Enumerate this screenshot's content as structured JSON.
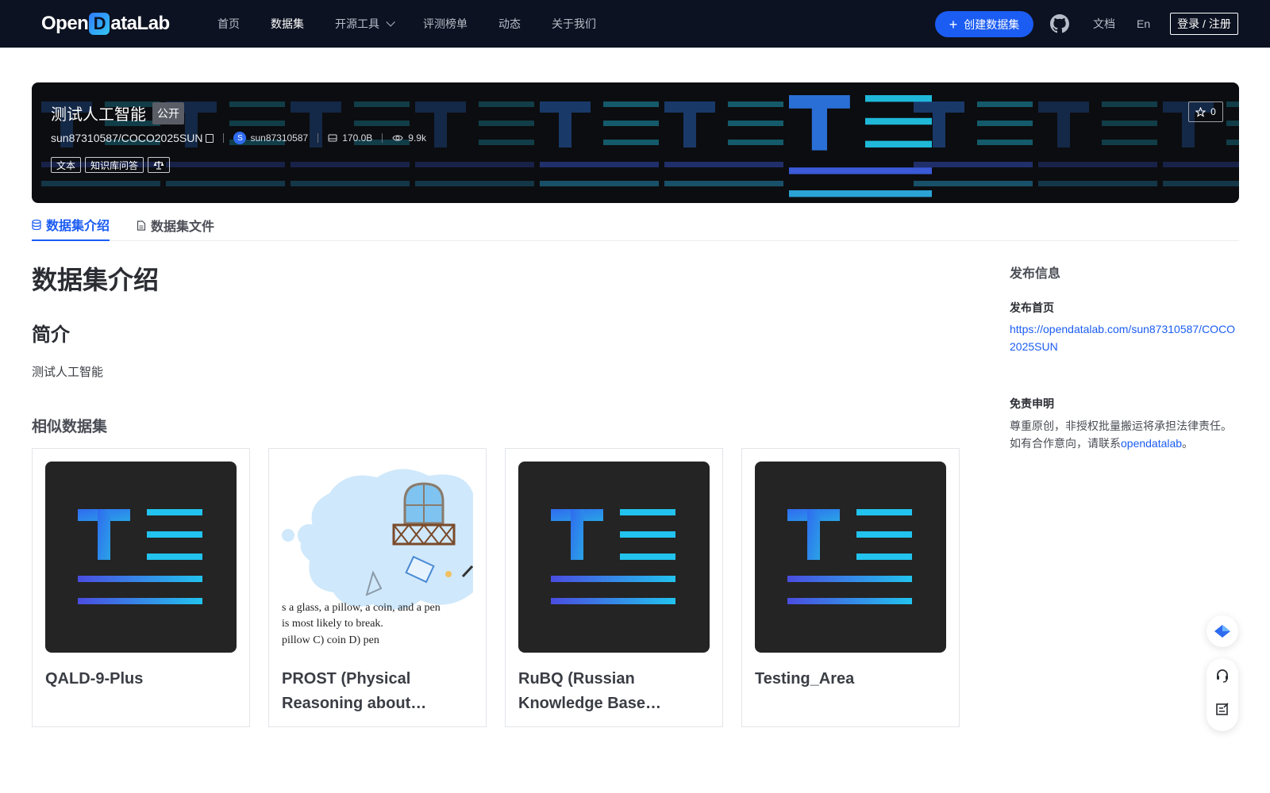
{
  "nav": {
    "logo_left": "Open",
    "logo_d": "D",
    "logo_right": "ataLab",
    "links": [
      "首页",
      "数据集",
      "开源工具",
      "评测榜单",
      "动态",
      "关于我们"
    ],
    "create_label": "创建数据集",
    "docs_label": "文档",
    "lang_label": "En",
    "login_label": "登录 / 注册"
  },
  "banner": {
    "title": "测试人工智能",
    "badge": "公开",
    "path": "sun87310587/COCO2025SUN",
    "avatar_letter": "S",
    "author": "sun87310587",
    "size": "170.0B",
    "views": "9.9k",
    "tags": [
      "文本",
      "知识库问答"
    ],
    "star_count": "0"
  },
  "tabs": [
    {
      "label": "数据集介绍",
      "icon": "database-icon"
    },
    {
      "label": "数据集文件",
      "icon": "file-icon"
    }
  ],
  "main": {
    "heading": "数据集介绍",
    "brief_heading": "简介",
    "brief_text": "测试人工智能",
    "similar_heading": "相似数据集"
  },
  "similar": [
    {
      "title": "QALD-9-Plus",
      "thumb": "text-dataset-icon"
    },
    {
      "title": "PROST (Physical Reasoning about…",
      "thumb": "prost-illustration",
      "q_line1": "s a glass, a pillow, a coin, and a pen",
      "q_line2": "is most likely to break.",
      "q_line3": "pillow    C) coin    D) pen"
    },
    {
      "title": "RuBQ (Russian Knowledge Base…",
      "thumb": "text-dataset-icon"
    },
    {
      "title": "Testing_Area",
      "thumb": "text-dataset-icon"
    }
  ],
  "side": {
    "heading": "发布信息",
    "home_label": "发布首页",
    "home_url": "https://opendatalab.com/sun87310587/COCO2025SUN",
    "disclaimer_label": "免责申明",
    "disclaimer_text": "尊重原创，非授权批量搬运将承担法律责任。如有合作意向，请联系",
    "disclaimer_link": "opendatalab",
    "disclaimer_end": "。"
  },
  "colors": {
    "nav_bg": "#0c1221",
    "accent": "#1b5cf3",
    "banner_bg": "#0c0d10"
  }
}
